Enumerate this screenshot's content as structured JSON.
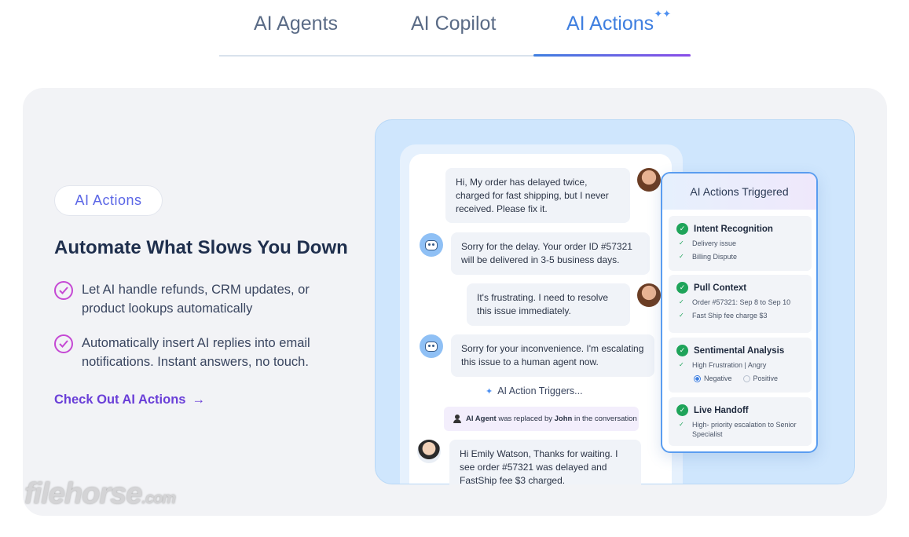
{
  "tabs": [
    {
      "label": "AI Agents"
    },
    {
      "label": "AI Copilot"
    },
    {
      "label": "AI Actions"
    }
  ],
  "section": {
    "pill": "AI Actions",
    "headline": "Automate What Slows You Down",
    "bullets": [
      "Let AI handle refunds, CRM updates, or product lookups automatically",
      "Automatically insert AI replies into email notifications. Instant answers, no touch."
    ],
    "cta": "Check Out AI Actions",
    "cta_arrow": "→"
  },
  "chat": {
    "messages": [
      {
        "from": "user",
        "text": "Hi, My order has delayed twice, charged for fast shipping, but I never received. Please fix it."
      },
      {
        "from": "bot",
        "text": "Sorry for the delay. Your order ID #57321 will be delivered in 3-5 business days."
      },
      {
        "from": "user",
        "text": "It's frustrating. I need to resolve this issue immediately."
      },
      {
        "from": "bot",
        "text": "Sorry for your inconvenience. I'm escalating this issue to a human agent now."
      },
      {
        "from": "agent",
        "text": "Hi Emily Watson, Thanks for waiting. I see order #57321 was delayed and FastShip fee $3 charged."
      }
    ],
    "trigger_text": "AI Action Triggers...",
    "replaced_bold_1": "AI Agent",
    "replaced_mid": "was replaced by",
    "replaced_bold_2": "John",
    "replaced_end": "in the conversation"
  },
  "actions_card": {
    "title": "AI Actions Triggered",
    "groups": [
      {
        "title": "Intent Recognition",
        "items": [
          "Delivery issue",
          "Billing Dispute"
        ]
      },
      {
        "title": "Pull Context",
        "items": [
          "Order #57321: Sep 8 to Sep 10",
          "Fast Ship fee charge $3"
        ]
      },
      {
        "title": "Sentimental Analysis",
        "items": [
          "High Frustration | Angry"
        ],
        "radio_a": "Negative",
        "radio_b": "Positive"
      },
      {
        "title": "Live Handoff",
        "items": [
          "High- priority escalation to Senior Specialist"
        ]
      }
    ]
  },
  "watermark": {
    "main": "filehorse",
    "tld": ".com"
  },
  "colors": {
    "accent_blue": "#3f7fe0",
    "accent_purple": "#6a3fd8",
    "check_green": "#1fa45a"
  }
}
